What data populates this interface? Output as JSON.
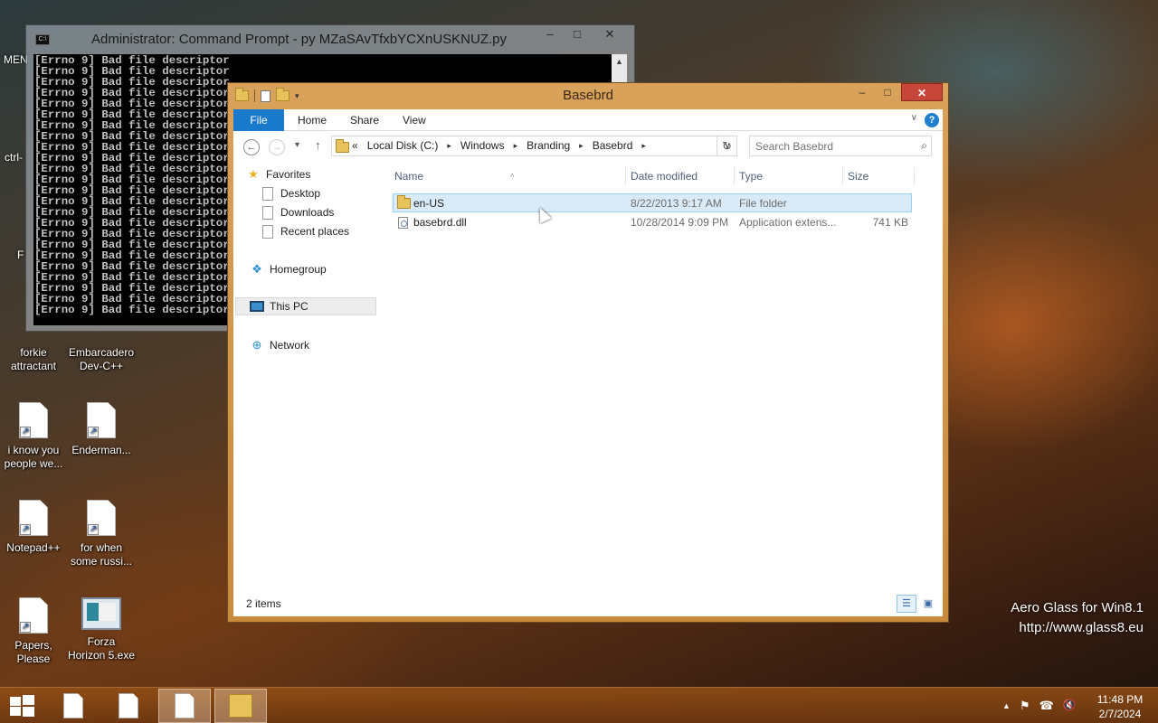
{
  "desktop": {
    "icons": [
      {
        "label": "forkie\nattractant"
      },
      {
        "label": "Embarcadero\nDev-C++"
      },
      {
        "label": "i know you\npeople we..."
      },
      {
        "label": "Enderman..."
      },
      {
        "label": "Notepad++"
      },
      {
        "label": "for when\nsome russi..."
      },
      {
        "label": "Papers,\nPlease"
      },
      {
        "label": "Forza\nHorizon 5.exe"
      }
    ],
    "partial_labels": {
      "men": "MEN",
      "ctrl": "ctrl-",
      "f": "F"
    }
  },
  "cmd": {
    "title": "Administrator: Command Prompt - py  MZaSAvTfxbYCXnUSKNUZ.py",
    "icon_text": "C:\\",
    "line": "[Errno 9] Bad file descriptor",
    "line_count": 24,
    "minimize": "–",
    "maximize": "□",
    "close": "✕",
    "scroll_up": "▲"
  },
  "explorer": {
    "title": "Basebrd",
    "minimize": "–",
    "maximize": "□",
    "close": "✕",
    "ribbon": {
      "tabs": {
        "file": "File",
        "home": "Home",
        "share": "Share",
        "view": "View"
      },
      "expand": "∨",
      "help": "?"
    },
    "nav": {
      "back": "←",
      "forward": "→",
      "recent": "▾",
      "up": "↑"
    },
    "address": {
      "overflow": "«",
      "crumbs": {
        "c0": "Local Disk (C:)",
        "c1": "Windows",
        "c2": "Branding",
        "c3": "Basebrd"
      },
      "sep": "▸",
      "dropdown": "∨",
      "refresh": "↻"
    },
    "search": {
      "placeholder": "Search Basebrd",
      "icon": "⌕"
    },
    "navpane": {
      "favorites": "Favorites",
      "desktop": "Desktop",
      "downloads": "Downloads",
      "recent_places": "Recent places",
      "homegroup": "Homegroup",
      "this_pc": "This PC",
      "network": "Network"
    },
    "columns": {
      "name": "Name",
      "date_modified": "Date modified",
      "type": "Type",
      "size": "Size",
      "sort_indicator": "˄"
    },
    "files": [
      {
        "name": "en-US",
        "date": "8/22/2013 9:17 AM",
        "type": "File folder",
        "size": ""
      },
      {
        "name": "basebrd.dll",
        "date": "10/28/2014 9:09 PM",
        "type": "Application extens...",
        "size": "741 KB"
      }
    ],
    "status": {
      "count": "2 items",
      "details_view": "☰",
      "icons_view": "▣"
    }
  },
  "watermark": {
    "line1": "Aero Glass for Win8.1",
    "line2": "http://www.glass8.eu"
  },
  "taskbar": {
    "clock_time": "11:48 PM",
    "clock_date": "2/7/2024",
    "tray": {
      "chevron": "▲",
      "flag": "⚑",
      "network": "☎",
      "volume": "🔇"
    }
  }
}
